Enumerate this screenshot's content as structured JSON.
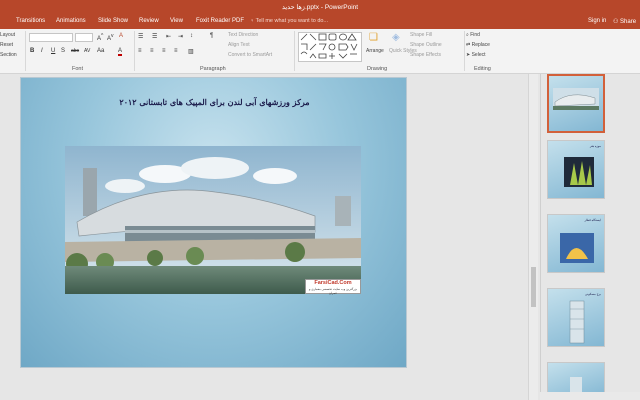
{
  "window": {
    "title": "زها حدید.pptx - PowerPoint"
  },
  "tabs": [
    "Transitions",
    "Animations",
    "Slide Show",
    "Review",
    "View",
    "Foxit Reader PDF"
  ],
  "tell_me": "Tell me what you want to do...",
  "account": {
    "sign_in": "Sign in",
    "share": "Share"
  },
  "ribbon": {
    "slides": {
      "layout": "Layout",
      "reset": "Reset",
      "section": "Section"
    },
    "groups": {
      "font": "Font",
      "paragraph": "Paragraph",
      "drawing": "Drawing",
      "editing": "Editing"
    },
    "font_buttons": [
      "B",
      "I",
      "U",
      "S",
      "abc",
      "AV",
      "Aa",
      "A"
    ],
    "paragraph": {
      "text_direction": "Text Direction",
      "align_text": "Align Text",
      "convert": "Convert to SmartArt"
    },
    "drawing": {
      "arrange": "Arrange",
      "quick_styles": "Quick Styles",
      "shape_fill": "Shape Fill",
      "shape_outline": "Shape Outline",
      "shape_effects": "Shape Effects"
    },
    "editing": {
      "find": "Find",
      "replace": "Replace",
      "select": "Select"
    }
  },
  "slide": {
    "title": "مرکز ورزشهای آبی لندن برای المپیک های تابستانی ۲۰۱۲",
    "logo": {
      "main": "FarsiCad.Com",
      "sub": "بزرگترین وب سایت تخصصی معماری و عمران"
    }
  },
  "thumbnails": [
    {
      "text": ""
    },
    {
      "text": "موزه هنر"
    },
    {
      "text": "ایستگاه قطار"
    },
    {
      "text": "برج مسکونی"
    },
    {
      "text": ""
    }
  ],
  "colors": {
    "accent": "#b7472a",
    "slide_bg": "#96c5db",
    "active_thumb": "#d2603a"
  }
}
